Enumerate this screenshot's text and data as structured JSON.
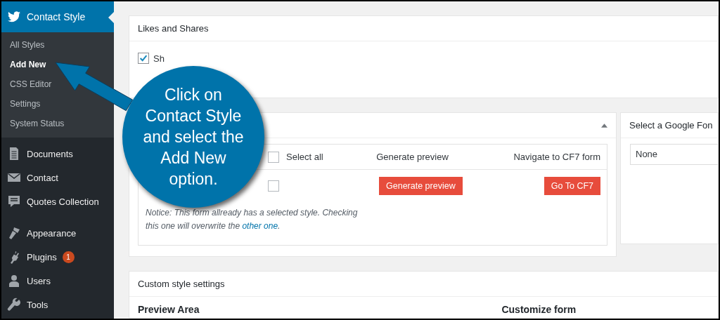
{
  "sidebar": {
    "header": {
      "label": "Contact Style",
      "selected": true
    },
    "submenu": [
      {
        "label": "All Styles",
        "selected": false
      },
      {
        "label": "Add New",
        "selected": true
      },
      {
        "label": "CSS Editor",
        "selected": false
      },
      {
        "label": "Settings",
        "selected": false
      },
      {
        "label": "System Status",
        "selected": false
      }
    ],
    "items": [
      {
        "label": "Documents"
      },
      {
        "label": "Contact"
      },
      {
        "label": "Quotes Collection"
      },
      {
        "label": "Appearance"
      },
      {
        "label": "Plugins",
        "badge": "1"
      },
      {
        "label": "Users"
      },
      {
        "label": "Tools"
      }
    ]
  },
  "likes_panel": {
    "title": "Likes and Shares",
    "checkbox": {
      "label": "Sh",
      "checked": true
    }
  },
  "forms_panel": {
    "expanded": true,
    "columns": [
      {
        "label": "Select all",
        "checked": false
      },
      {
        "label": "Generate preview"
      },
      {
        "label": "Navigate to CF7 form"
      }
    ],
    "row": {
      "checked": false,
      "preview_button": "Generate preview",
      "cf7_button": "Go To CF7"
    },
    "notice": "Notice: This form allready has a selected style. Checking this one will overwrite the ",
    "notice_link": "other one",
    "notice_end": "."
  },
  "font_panel": {
    "title": "Select a Google Fon",
    "select": "None"
  },
  "custom_panel": {
    "title": "Custom style settings",
    "column_1": "Preview Area",
    "column_2": "Customize form"
  },
  "callout": {
    "text": "Click on Contact Style and select the Add New option."
  }
}
